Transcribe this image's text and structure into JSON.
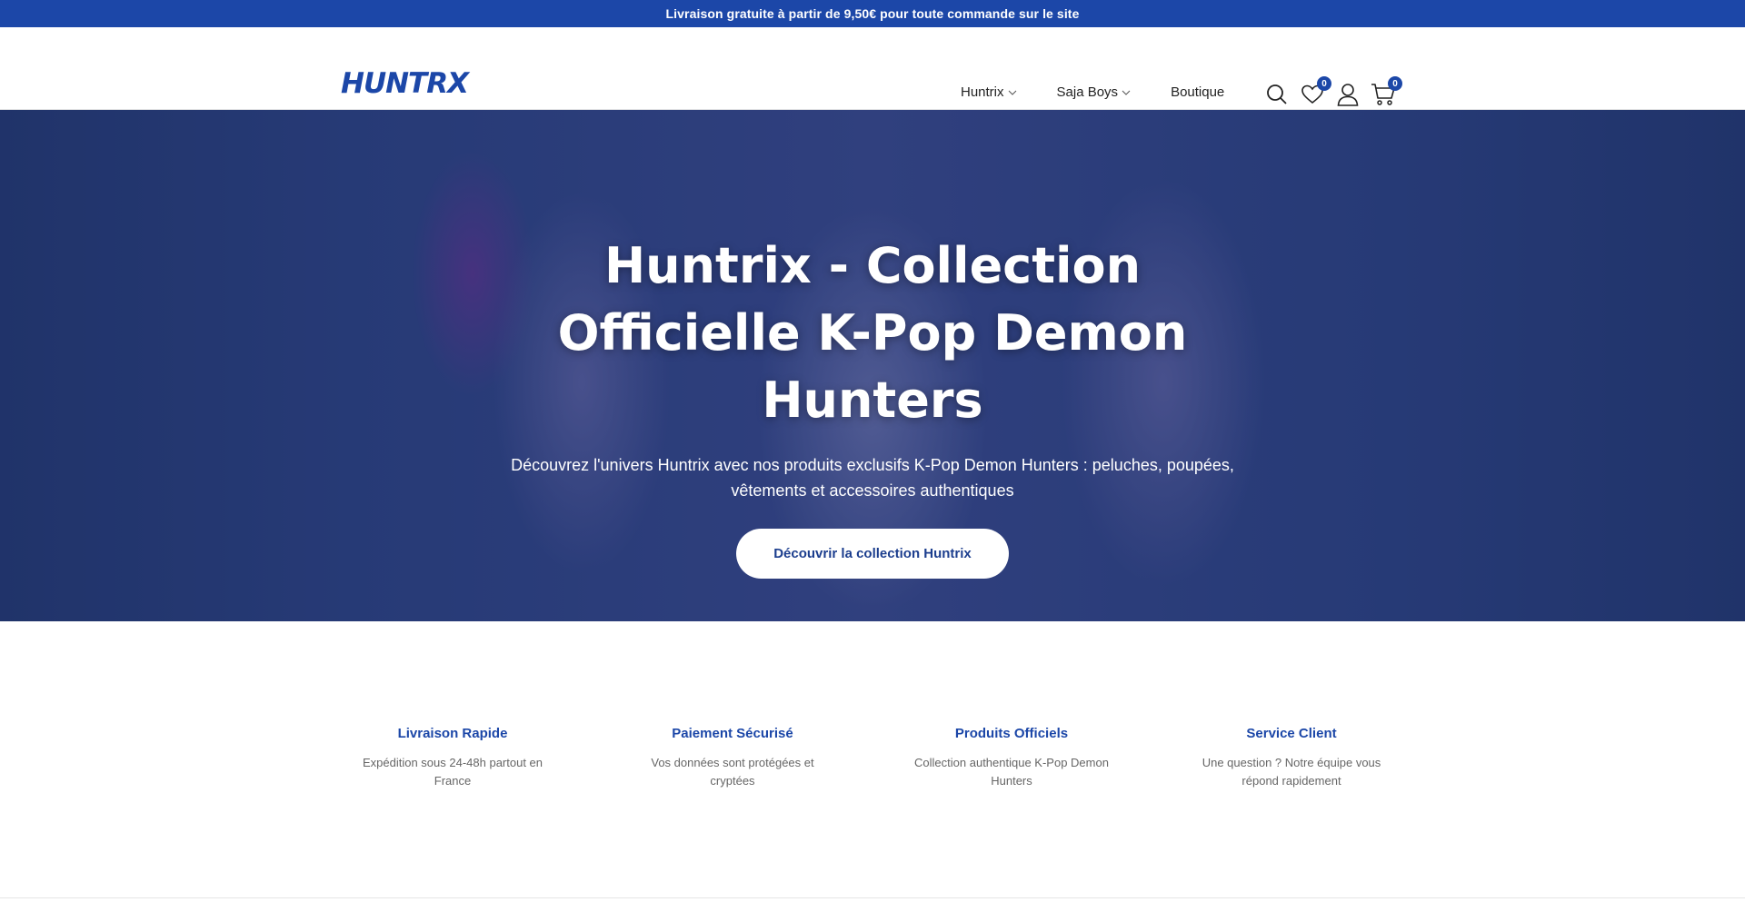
{
  "topbar": {
    "text": "Livraison gratuite à partir de 9,50€ pour toute commande sur le site"
  },
  "header": {
    "logo_text": "HUNTRX",
    "nav": [
      {
        "label": "Huntrix",
        "has_dropdown": true
      },
      {
        "label": "Saja Boys",
        "has_dropdown": true
      },
      {
        "label": "Boutique",
        "has_dropdown": false
      }
    ],
    "icons": {
      "search": "search-icon",
      "wishlist": "heart-icon",
      "wishlist_count": "0",
      "account": "user-icon",
      "cart": "cart-icon",
      "cart_count": "0"
    }
  },
  "hero": {
    "title": "Huntrix - Collection Officielle K-Pop Demon Hunters",
    "subtitle": "Découvrez l'univers Huntrix avec nos produits exclusifs K-Pop Demon Hunters : peluches, poupées, vêtements et accessoires authentiques",
    "cta": "Découvrir la collection Huntrix"
  },
  "features": [
    {
      "icon": "",
      "title": "Livraison Rapide",
      "desc": "Expédition sous 24-48h partout en France"
    },
    {
      "icon": "",
      "title": "Paiement Sécurisé",
      "desc": "Vos données sont protégées et cryptées"
    },
    {
      "icon": "",
      "title": "Produits Officiels",
      "desc": "Collection authentique K-Pop Demon Hunters"
    },
    {
      "icon": "",
      "title": "Service Client",
      "desc": "Une question ? Notre équipe vous répond rapidement"
    }
  ],
  "colors": {
    "brand": "#1c47a8",
    "hero_overlay": "#2c4180"
  }
}
